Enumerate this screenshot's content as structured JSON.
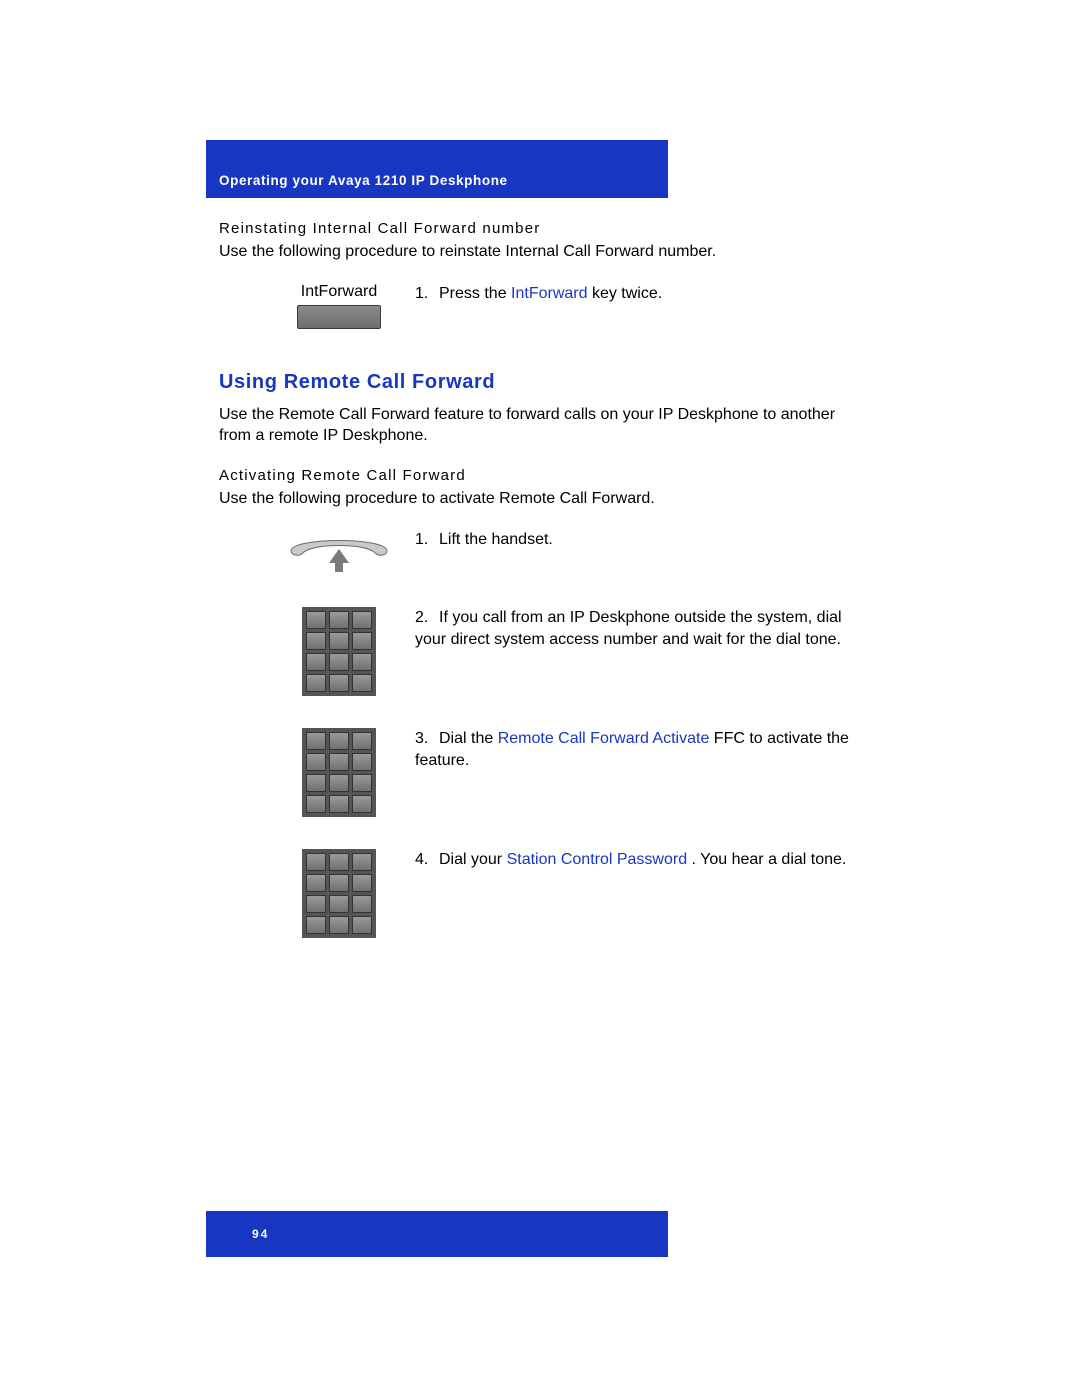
{
  "header": {
    "title": "Operating your Avaya 1210 IP Deskphone"
  },
  "section1": {
    "subheading": "Reinstating Internal Call Forward number",
    "intro": "Use the following procedure to reinstate Internal Call Forward number.",
    "key_label": "IntForward",
    "step1_num": "1.",
    "step1_a": "Press the ",
    "step1_link": "IntForward",
    "step1_b": "  key twice."
  },
  "section2": {
    "heading": "Using Remote Call Forward",
    "intro": "Use the Remote Call Forward feature to forward calls on your IP Deskphone to another from a remote IP Deskphone.",
    "subheading": "Activating Remote Call Forward",
    "intro2": "Use the following procedure to activate Remote Call Forward.",
    "step1_num": "1.",
    "step1": "Lift the handset.",
    "step2_num": "2.",
    "step2": "If you call from an IP Deskphone outside the system, dial your direct system access number and wait for the dial tone.",
    "step3_num": "3.",
    "step3_a": "Dial the ",
    "step3_link": "Remote Call Forward Activate",
    "step3_b": " FFC to activate the feature.",
    "step4_num": "4.",
    "step4_a": "Dial your ",
    "step4_link": "Station Control Password",
    "step4_b": "   . You hear a dial tone."
  },
  "footer": {
    "page": "94"
  }
}
